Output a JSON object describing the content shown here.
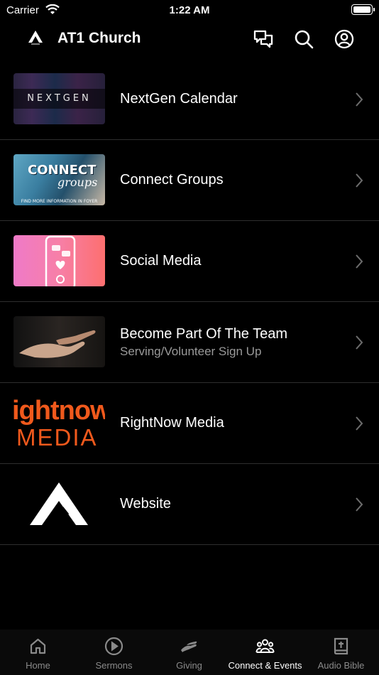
{
  "status_bar": {
    "carrier": "Carrier",
    "time": "1:22 AM"
  },
  "header": {
    "title": "AT1 Church"
  },
  "icons": {
    "header": [
      "chat-icon",
      "search-icon",
      "account-icon"
    ]
  },
  "items": [
    {
      "title": "NextGen Calendar",
      "subtitle": "",
      "thumb_text": "NEXTGEN"
    },
    {
      "title": "Connect Groups",
      "subtitle": "",
      "thumb_text": "CONNECT",
      "thumb_script": "groups",
      "thumb_foot": "FIND MORE INFORMATION IN FOYER"
    },
    {
      "title": "Social Media",
      "subtitle": ""
    },
    {
      "title": "Become Part Of The Team",
      "subtitle": "Serving/Volunteer Sign Up"
    },
    {
      "title": "RightNow Media",
      "subtitle": "",
      "thumb_text": "ightnow",
      "thumb_text2": "MEDIA"
    },
    {
      "title": "Website",
      "subtitle": ""
    }
  ],
  "tabs": [
    {
      "label": "Home",
      "icon": "home-icon",
      "active": false
    },
    {
      "label": "Sermons",
      "icon": "play-icon",
      "active": false
    },
    {
      "label": "Giving",
      "icon": "giving-icon",
      "active": false
    },
    {
      "label": "Connect & Events",
      "icon": "people-icon",
      "active": true
    },
    {
      "label": "Audio Bible",
      "icon": "bible-icon",
      "active": false
    }
  ],
  "colors": {
    "background": "#000000",
    "divider": "#2e2e2e",
    "subtitle": "#9a9a9a",
    "tab_inactive": "#8a8a8a",
    "rightnow_orange": "#f0591c"
  }
}
